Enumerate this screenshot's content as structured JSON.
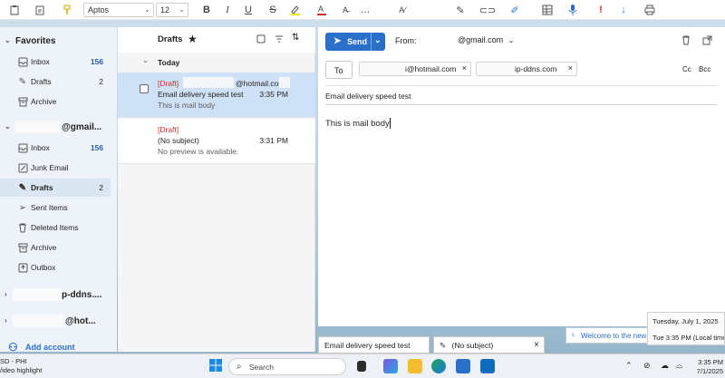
{
  "toolbar": {
    "font_name": "Aptos",
    "font_size": "12",
    "icons": [
      "clipboard-icon",
      "paste-icon",
      "format-painter-icon",
      "bold-icon",
      "italic-icon",
      "underline-icon",
      "strikethrough-icon",
      "highlight-icon",
      "font-color-icon",
      "clear-format-icon",
      "more-icon",
      "styles-icon",
      "sign-icon",
      "link-icon",
      "draw-icon",
      "table-icon",
      "dictate-icon",
      "importance-icon",
      "low-importance-icon",
      "print-icon"
    ]
  },
  "folder_pane": {
    "favorites_label": "Favorites",
    "favorites": [
      {
        "label": "Inbox",
        "count": "156",
        "icon": "inbox-icon"
      },
      {
        "label": "Drafts",
        "count": "2",
        "icon": "drafts-icon"
      },
      {
        "label": "Archive",
        "count": "",
        "icon": "archive-icon"
      }
    ],
    "account1": "@gmail...",
    "account1_folders": [
      {
        "label": "Inbox",
        "count": "156",
        "icon": "inbox-icon"
      },
      {
        "label": "Junk Email",
        "count": "",
        "icon": "junk-icon"
      },
      {
        "label": "Drafts",
        "count": "2",
        "icon": "drafts-icon"
      },
      {
        "label": "Sent Items",
        "count": "",
        "icon": "sent-icon"
      },
      {
        "label": "Deleted Items",
        "count": "",
        "icon": "trash-icon"
      },
      {
        "label": "Archive",
        "count": "",
        "icon": "archive-icon"
      },
      {
        "label": "Outbox",
        "count": "",
        "icon": "outbox-icon"
      }
    ],
    "account2": "p-ddns....",
    "account3": "@hot...",
    "add_account": "Add account"
  },
  "message_list": {
    "title": "Drafts",
    "group": "Today",
    "messages": [
      {
        "tag": "[Draft]",
        "to": "@hotmail.com;",
        "subject": "Email delivery speed test",
        "time": "3:35 PM",
        "preview": "This is mail body"
      },
      {
        "tag": "[Draft]",
        "to": "",
        "subject": "(No subject)",
        "time": "3:31 PM",
        "preview": "No preview is available."
      }
    ]
  },
  "compose": {
    "send_label": "Send",
    "from_label": "From:",
    "from_value": "@gmail.com",
    "to_label": "To",
    "recipients": [
      "i@hotmail.com",
      "ip-ddns.com"
    ],
    "cc": "Cc",
    "bcc": "Bcc",
    "subject": "Email delivery speed test",
    "body": "This is mail body"
  },
  "bottom_tabs": [
    "Email delivery speed test",
    "(No subject)"
  ],
  "notification": "Welcome to the new O",
  "tooltip": {
    "date": "Tuesday, July 1, 2025",
    "time": "Tue 3:35 PM (Local time)"
  },
  "taskbar": {
    "left_line1": "SD - PHI",
    "left_line2": "/ideo highlight",
    "search": "Search",
    "clock_time": "3:35 PM",
    "clock_date": "7/1/2025"
  },
  "colors": {
    "accent": "#2a6fc9",
    "draft_red": "#c4332b",
    "unread_blue": "#2b5ea7"
  }
}
